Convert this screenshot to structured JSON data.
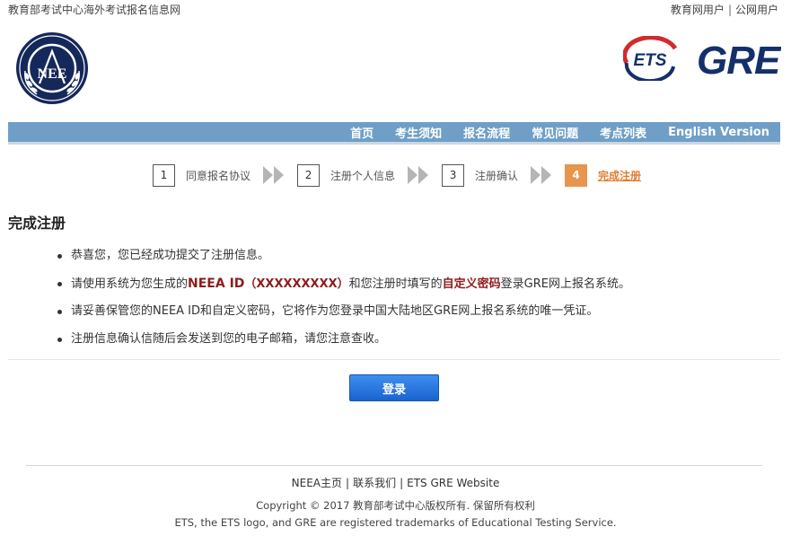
{
  "header": {
    "site_title": "教育部考试中心海外考试报名信息网",
    "user_links": [
      "教育网用户",
      "公网用户"
    ],
    "user_link_separator": "|"
  },
  "logos": {
    "neea": {
      "icon": "neea-logo",
      "text": "NEE"
    },
    "ets": {
      "icon": "ets-logo",
      "text": "ETS"
    },
    "gre": {
      "icon": "gre-logo",
      "text": "GRE"
    }
  },
  "nav": {
    "items": [
      "首页",
      "考生须知",
      "报名流程",
      "常见问题",
      "考点列表",
      "English Version"
    ]
  },
  "steps": [
    {
      "num": "1",
      "label": "同意报名协议",
      "active": false
    },
    {
      "num": "2",
      "label": "注册个人信息",
      "active": false
    },
    {
      "num": "3",
      "label": "注册确认",
      "active": false
    },
    {
      "num": "4",
      "label": "完成注册",
      "active": true
    }
  ],
  "main": {
    "title": "完成注册",
    "item1": "恭喜您，您已经成功提交了注册信息。",
    "item2": {
      "pre": "请使用系统为您生成的",
      "id_label": "NEEA ID",
      "id_value": "（XXXXXXXXX）",
      "mid": "和您注册时填写的",
      "pwd_label": "自定义密码",
      "post": "登录GRE网上报名系统。"
    },
    "item3": "请妥善保管您的NEEA ID和自定义密码，它将作为您登录中国大陆地区GRE网上报名系统的唯一凭证。",
    "item4": "注册信息确认信随后会发送到您的电子邮箱，请您注意查收。",
    "login_button": "登录"
  },
  "footer": {
    "links": [
      "NEEA主页",
      "联系我们",
      "ETS GRE Website"
    ],
    "separator": "|",
    "copyright": "Copyright © 2017 教育部考试中心版权所有. 保留所有权利",
    "trademark": "ETS, the ETS logo, and GRE are registered trademarks of Educational Testing Service."
  },
  "colors": {
    "nav_bg": "#6f9fc6",
    "active_step": "#e8954e",
    "highlight": "#8e1c1c",
    "button": "#1a63cf",
    "ets_red": "#d12c2e",
    "gre_navy": "#13306b",
    "neea_navy": "#15285a"
  }
}
